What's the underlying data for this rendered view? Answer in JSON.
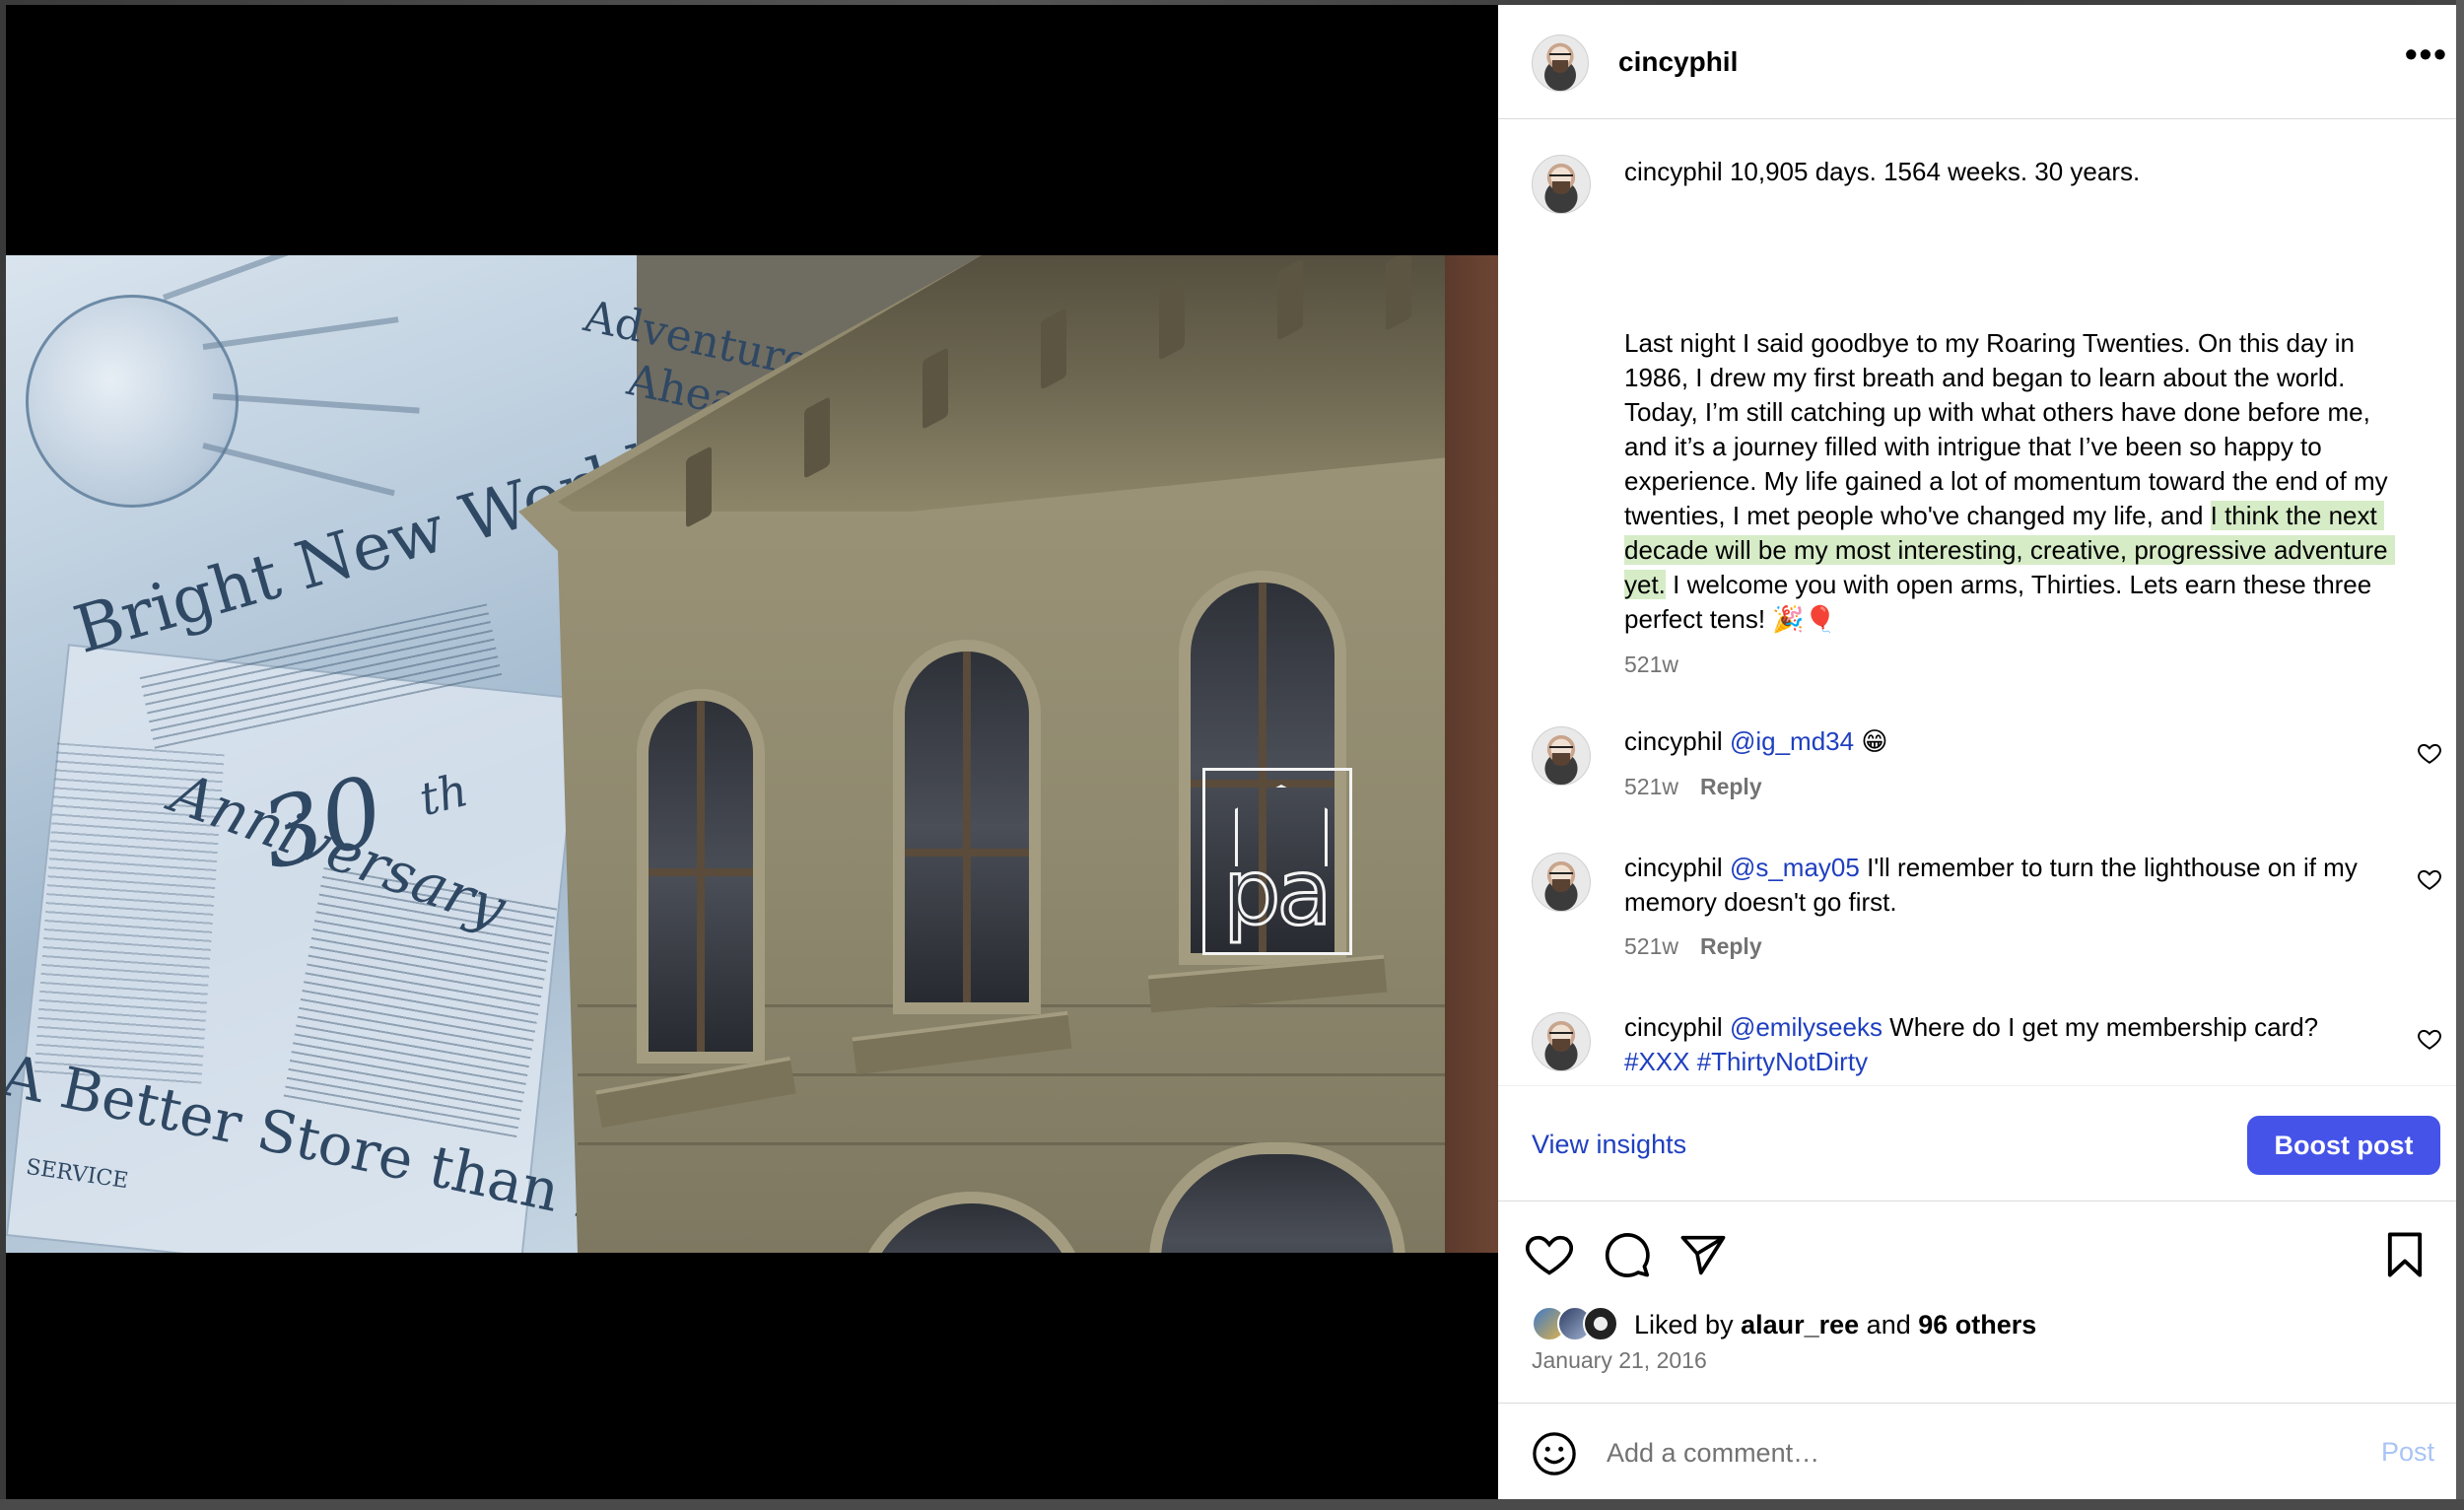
{
  "post": {
    "username": "cincyphil",
    "more_label": "•••"
  },
  "caption": {
    "username": "cincyphil",
    "first_line": "10,905 days. 1564 weeks. 30 years.",
    "body_before_highlight": "Last night I said goodbye to my Roaring Twenties. On this day in 1986, I drew my first breath and began to learn about the world. Today, I’m still catching up with what others have done before me, and it’s a journey filled with intrigue that I’ve been so happy to experience. My life gained a lot of momentum toward the end of my twenties, I met people who've changed my life, and ",
    "body_highlight": "I think the next decade will be my most interesting, creative, progressive adventure yet.",
    "body_after_highlight": " I welcome you with open arms, Thirties. Lets earn these three perfect tens! 🎉🎈",
    "age": "521w"
  },
  "comments": [
    {
      "username": "cincyphil",
      "mention": "@ig_md34",
      "text": " 😁",
      "age": "521w",
      "reply_label": "Reply"
    },
    {
      "username": "cincyphil",
      "mention": "@s_may05",
      "text": " I'll remember to turn the lighthouse on if my memory doesn't go first.",
      "age": "521w",
      "reply_label": "Reply"
    },
    {
      "username": "cincyphil",
      "mention": "@emilyseeks",
      "text": " Where do I get my membership card?",
      "hashtags": "#XXX #ThirtyNotDirty"
    }
  ],
  "insights": {
    "view_label": "View insights",
    "boost_label": "Boost post"
  },
  "actions": {
    "like_icon": "heart-outline",
    "comment_icon": "speech-bubble",
    "share_icon": "paper-plane",
    "save_icon": "bookmark"
  },
  "likes": {
    "prefix": "Liked by ",
    "first_liker": "alaur_ree",
    "joiner": " and ",
    "others": "96 others"
  },
  "post_date": "January 21, 2016",
  "comment_box": {
    "placeholder": "Add a comment…",
    "post_label": "Post"
  },
  "media": {
    "collage_words": [
      "Adventure",
      "Ahead",
      "Bright New World",
      "30",
      "th",
      "Anniversary",
      "A Better Store than Eve",
      "SERVICE"
    ],
    "sign_text": "pa"
  },
  "colors": {
    "link": "#1f3fbf",
    "boost": "#4553e8",
    "highlight": "#d6ecc7",
    "muted": "#737373",
    "post_disabled": "#a9c4f5"
  }
}
